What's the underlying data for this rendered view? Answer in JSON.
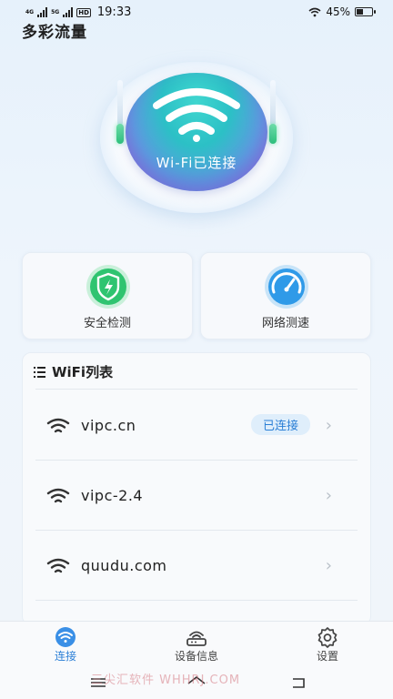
{
  "status_bar": {
    "net1": "4G",
    "net2": "5G",
    "net3": "HD",
    "time": "19:33",
    "battery": "45%"
  },
  "app": {
    "title": "多彩流量"
  },
  "hero": {
    "status": "Wi-Fi已连接",
    "icon": "wifi-icon"
  },
  "tools": [
    {
      "label": "安全检测",
      "icon": "shield-lightning-icon",
      "color": "#2fc470"
    },
    {
      "label": "网络测速",
      "icon": "speedometer-icon",
      "color": "#2f9ae8"
    }
  ],
  "wifi_list": {
    "title": "WiFi列表",
    "items": [
      {
        "name": "vipc.cn",
        "badge": "已连接"
      },
      {
        "name": "vipc-2.4",
        "badge": ""
      },
      {
        "name": "quudu.com",
        "badge": ""
      }
    ]
  },
  "tabs": [
    {
      "label": "连接",
      "icon": "wifi-icon",
      "active": true
    },
    {
      "label": "设备信息",
      "icon": "router-icon",
      "active": false
    },
    {
      "label": "设置",
      "icon": "gear-icon",
      "active": false
    }
  ],
  "watermark": "三尖汇软件 WHHRJ.COM",
  "colors": {
    "accent": "#2b7fd6",
    "background": "#eaf3fc"
  }
}
